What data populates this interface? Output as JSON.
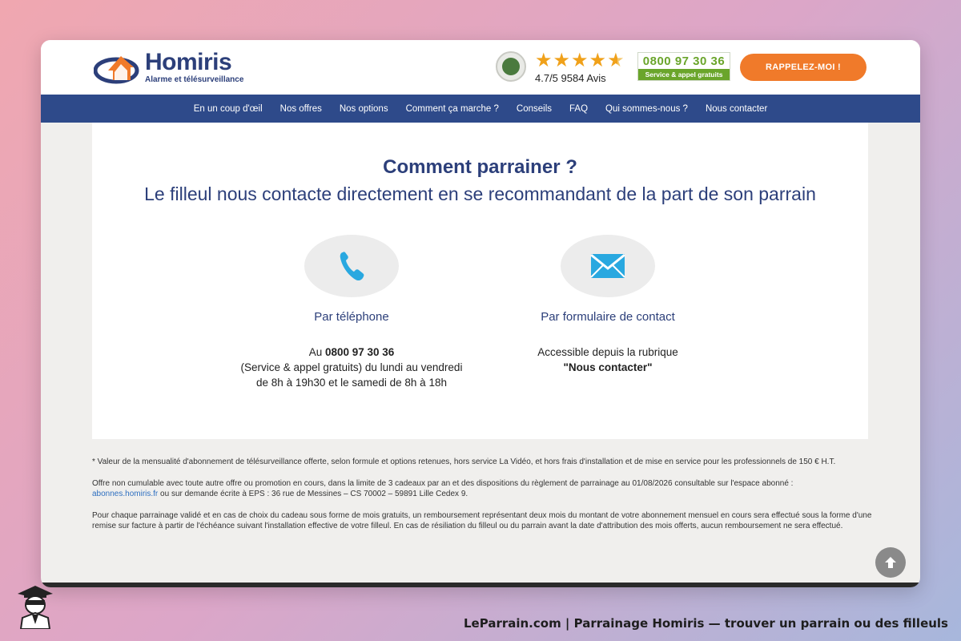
{
  "header": {
    "logo_name": "Homiris",
    "logo_sub": "Alarme et télésurveillance",
    "rating_text": "4.7/5 9584 Avis",
    "stars": 4.7,
    "phone_number": "0800 97 30 36",
    "phone_sub": "Service & appel gratuits",
    "callback_label": "RAPPELEZ-MOI !"
  },
  "nav": {
    "items": [
      {
        "label": "En un coup d'œil"
      },
      {
        "label": "Nos offres"
      },
      {
        "label": "Nos options"
      },
      {
        "label": "Comment ça marche ?"
      },
      {
        "label": "Conseils"
      },
      {
        "label": "FAQ"
      },
      {
        "label": "Qui sommes-nous ?"
      },
      {
        "label": "Nous contacter"
      }
    ]
  },
  "main": {
    "title": "Comment parrainer ?",
    "subtitle": "Le filleul nous contacte directement en se recommandant de la part de son parrain",
    "phone": {
      "title": "Par téléphone",
      "prefix": "Au ",
      "number": "0800 97 30 36",
      "line2": "(Service & appel gratuits) du lundi au vendredi",
      "line3": "de 8h à 19h30 et le samedi de 8h à 18h"
    },
    "form": {
      "title": "Par formulaire de contact",
      "line1": "Accessible depuis la rubrique",
      "line2": "\"Nous contacter\""
    }
  },
  "notes": {
    "p1": "* Valeur de la mensualité d'abonnement de télésurveillance offerte, selon formule et options retenues, hors service La Vidéo, et hors frais d'installation et de mise en service pour les professionnels de 150 € H.T.",
    "p2_text": "Offre non cumulable avec toute autre offre ou promotion en cours, dans la limite de 3 cadeaux par an et des dispositions du règlement de parrainage au 01/08/2026 consultable sur l'espace abonné :",
    "p2_link": "abonnes.homiris.fr",
    "p2_after": " ou sur demande écrite à EPS : 36 rue de Messines – CS 70002 – 59891 Lille Cedex 9.",
    "p3": "Pour chaque parrainage validé et en cas de choix du cadeau sous forme de mois gratuits, un remboursement représentant deux mois du montant de votre abonnement mensuel en cours sera effectué sous la forme d'une remise sur facture à partir de l'échéance suivant l'installation effective de votre filleul. En cas de résiliation du filleul ou du parrain avant la date d'attribution des mois offerts, aucun remboursement ne sera effectué."
  },
  "footer": {
    "caption": "LeParrain.com | Parrainage Homiris — trouver un parrain ou des filleuls"
  },
  "colors": {
    "brand_blue": "#2c3f7a",
    "nav_blue": "#2e4a8a",
    "accent_orange": "#f07a2a",
    "phone_green": "#6aa52b",
    "icon_blue": "#29a8e0"
  }
}
